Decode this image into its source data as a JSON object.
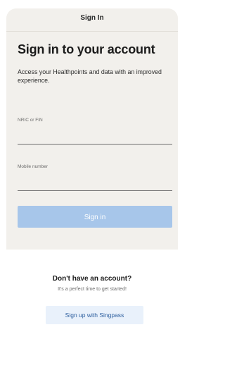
{
  "header": {
    "title": "Sign In"
  },
  "main": {
    "heading": "Sign in to your account",
    "subtext": "Access your Healthpoints and data with an improved experience.",
    "fields": [
      {
        "label": "NRIC or FIN",
        "value": "",
        "placeholder": ""
      },
      {
        "label": "Mobile number",
        "value": "",
        "placeholder": ""
      }
    ],
    "signin_label": "Sign in",
    "signin_color": "#a7c6ea"
  },
  "signup": {
    "heading": "Don't have an account?",
    "subtext": "It's a perfect time to get started!",
    "button_label": "Sign up with Singpass"
  }
}
